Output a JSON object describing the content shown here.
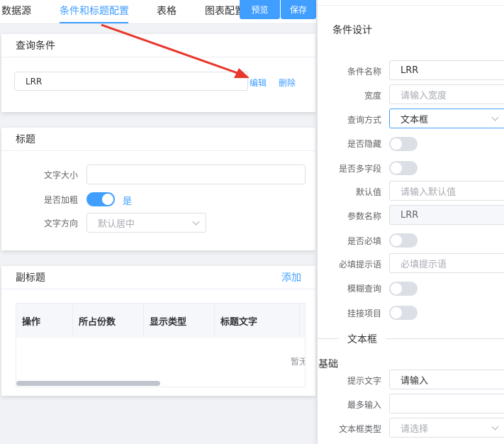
{
  "tabs": {
    "data_source": "数据源",
    "condition_title": "条件和标题配置",
    "table": "表格",
    "chart": "图表配置"
  },
  "actions": {
    "preview": "预览",
    "save": "保存"
  },
  "query_section": {
    "title": "查询条件",
    "condition_value": "LRR",
    "edit": "编辑",
    "delete": "删除"
  },
  "title_section": {
    "title": "标题",
    "font_size_label": "文字大小",
    "bold_label": "是否加粗",
    "bold_on": true,
    "bold_text": "是",
    "direction_label": "文字方向",
    "direction_placeholder": "默认居中"
  },
  "subtitle_section": {
    "title": "副标题",
    "add": "添加",
    "columns": [
      "操作",
      "所占份数",
      "显示类型",
      "标题文字"
    ],
    "empty": "暂无"
  },
  "condition_design": {
    "title": "条件设计",
    "fields": {
      "name_label": "条件名称",
      "name_value": "LRR",
      "width_label": "宽度",
      "width_placeholder": "请输入宽度",
      "query_type_label": "查询方式",
      "query_type_value": "文本框",
      "hidden_label": "是否隐藏",
      "multi_label": "是否多字段",
      "default_label": "默认值",
      "default_placeholder": "请输入默认值",
      "param_label": "参数名称",
      "param_value": "LRR",
      "required_label": "是否必填",
      "required_tip_label": "必填提示语",
      "required_tip_placeholder": "必填提示语",
      "fuzzy_label": "模糊查询",
      "mount_label": "挂接项目"
    },
    "textbox_divider": "文本框",
    "basic": {
      "heading": "基础",
      "hint_label": "提示文字",
      "hint_value": "请输入",
      "max_label": "最多输入",
      "type_label": "文本框类型",
      "type_placeholder": "请选择"
    }
  },
  "colors": {
    "accent": "#409eff",
    "annotation_arrow": "#e8372c"
  }
}
